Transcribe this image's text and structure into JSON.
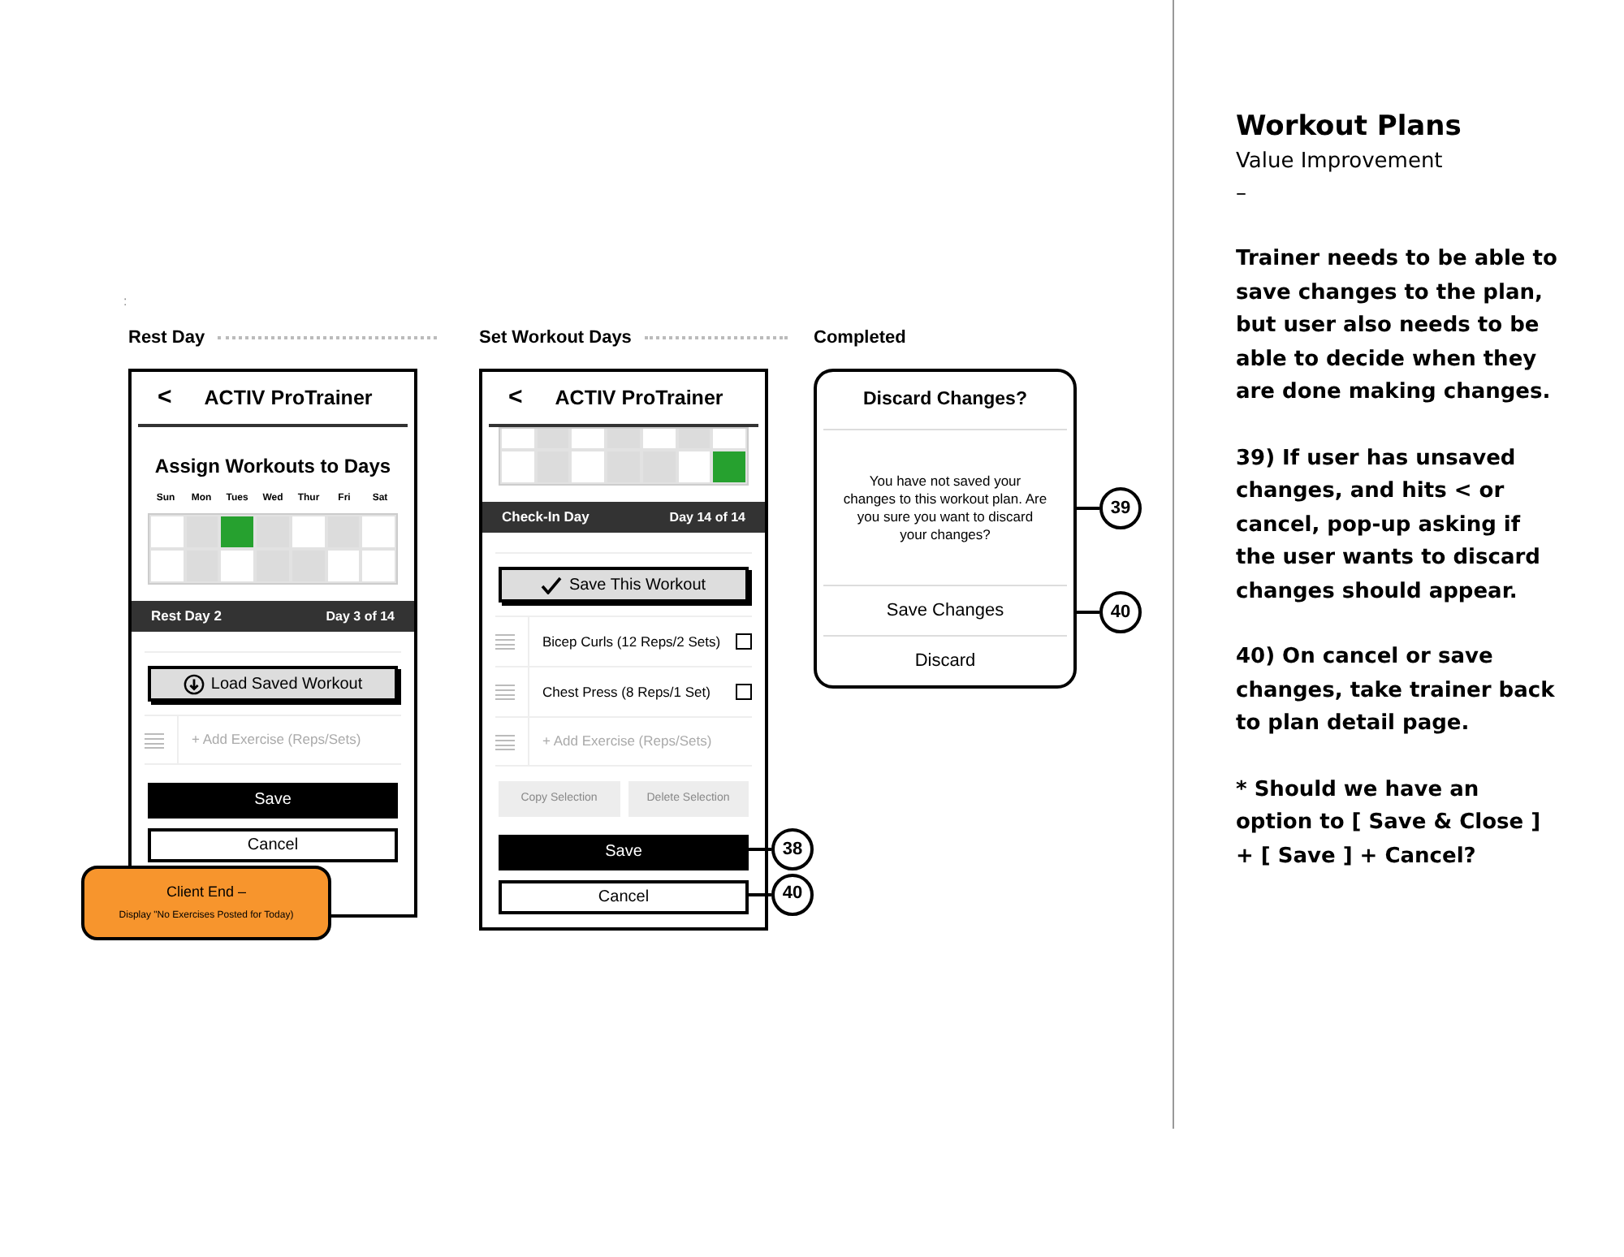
{
  "stray_mark": ":",
  "phone_screens": [
    {
      "label": "Rest Day",
      "back": "<",
      "app_title": "ACTIV ProTrainer",
      "heading": "Assign Workouts to Days",
      "weekdays": [
        "Sun",
        "Mon",
        "Tues",
        "Wed",
        "Thur",
        "Fri",
        "Sat"
      ],
      "grid": [
        [
          {
            "color": "#ffffff"
          },
          {
            "color": "#dcdcdc"
          },
          {
            "color": "#26a12f"
          },
          {
            "color": "#dcdcdc"
          },
          {
            "color": "#ffffff"
          },
          {
            "color": "#dcdcdc"
          },
          {
            "color": "#ffffff"
          }
        ],
        [
          {
            "color": "#ffffff"
          },
          {
            "color": "#dcdcdc"
          },
          {
            "color": "#ffffff"
          },
          {
            "color": "#dcdcdc"
          },
          {
            "color": "#dcdcdc"
          },
          {
            "color": "#ffffff"
          },
          {
            "color": "#ffffff"
          }
        ]
      ],
      "day_bar": {
        "name": "Rest Day 2",
        "count": "Day 3 of 14"
      },
      "action": {
        "kind": "load",
        "label": "Load Saved Workout"
      },
      "add_exercise": "+ Add Exercise (Reps/Sets)",
      "save": {
        "label": "Save"
      },
      "cancel": {
        "label": "Cancel"
      }
    },
    {
      "label": "Set Workout Days",
      "back": "<",
      "app_title": "ACTIV ProTrainer",
      "grid": [
        [
          {
            "color": "#ffffff"
          },
          {
            "color": "#dcdcdc"
          },
          {
            "color": "#ffffff"
          },
          {
            "color": "#dcdcdc"
          },
          {
            "color": "#ffffff"
          },
          {
            "color": "#dcdcdc"
          },
          {
            "color": "#ffffff"
          }
        ],
        [
          {
            "color": "#ffffff"
          },
          {
            "color": "#dcdcdc"
          },
          {
            "color": "#ffffff"
          },
          {
            "color": "#dcdcdc"
          },
          {
            "color": "#dcdcdc"
          },
          {
            "color": "#ffffff"
          },
          {
            "color": "#26a12f"
          }
        ]
      ],
      "day_bar": {
        "name": "Check-In Day",
        "count": "Day 14 of 14"
      },
      "action": {
        "kind": "save",
        "label": "Save This Workout"
      },
      "exercises": [
        {
          "name": "Bicep Curls (12 Reps/2 Sets)",
          "checked": false
        },
        {
          "name": "Chest Press (8 Reps/1 Set)",
          "checked": false
        }
      ],
      "add_exercise": "+ Add Exercise (Reps/Sets)",
      "selection_buttons": [
        {
          "label": "Copy Selection",
          "disabled": true
        },
        {
          "label": "Delete Selection",
          "disabled": true
        }
      ],
      "save": {
        "label": "Save",
        "callout": "38"
      },
      "cancel": {
        "label": "Cancel",
        "callout": "40"
      }
    }
  ],
  "dialog_screen": {
    "label": "Completed",
    "title": "Discard Changes?",
    "message": "You have not saved your changes to this workout plan. Are you sure you want to discard your changes?",
    "message_callout": "39",
    "options": [
      {
        "label": "Save Changes",
        "callout": "40"
      },
      {
        "label": "Discard"
      }
    ]
  },
  "sticky_note": {
    "title": "Client End –",
    "text": "Display \"No Exercises Posted for Today)"
  },
  "notes": {
    "title": "Workout Plans",
    "subtitle": "Value Improvement",
    "dash": "–",
    "paragraphs": [
      "Trainer needs to be able to save changes to the plan, but user also needs to be able to decide when they are done making changes.",
      "39) If user has unsaved changes, and hits < or cancel, pop-up asking if the user wants to discard changes should appear.",
      "40) On cancel or save changes, take trainer back to plan detail page.",
      "* Should we have an option to [ Save & Close ] + [ Save ] + Cancel?"
    ]
  }
}
